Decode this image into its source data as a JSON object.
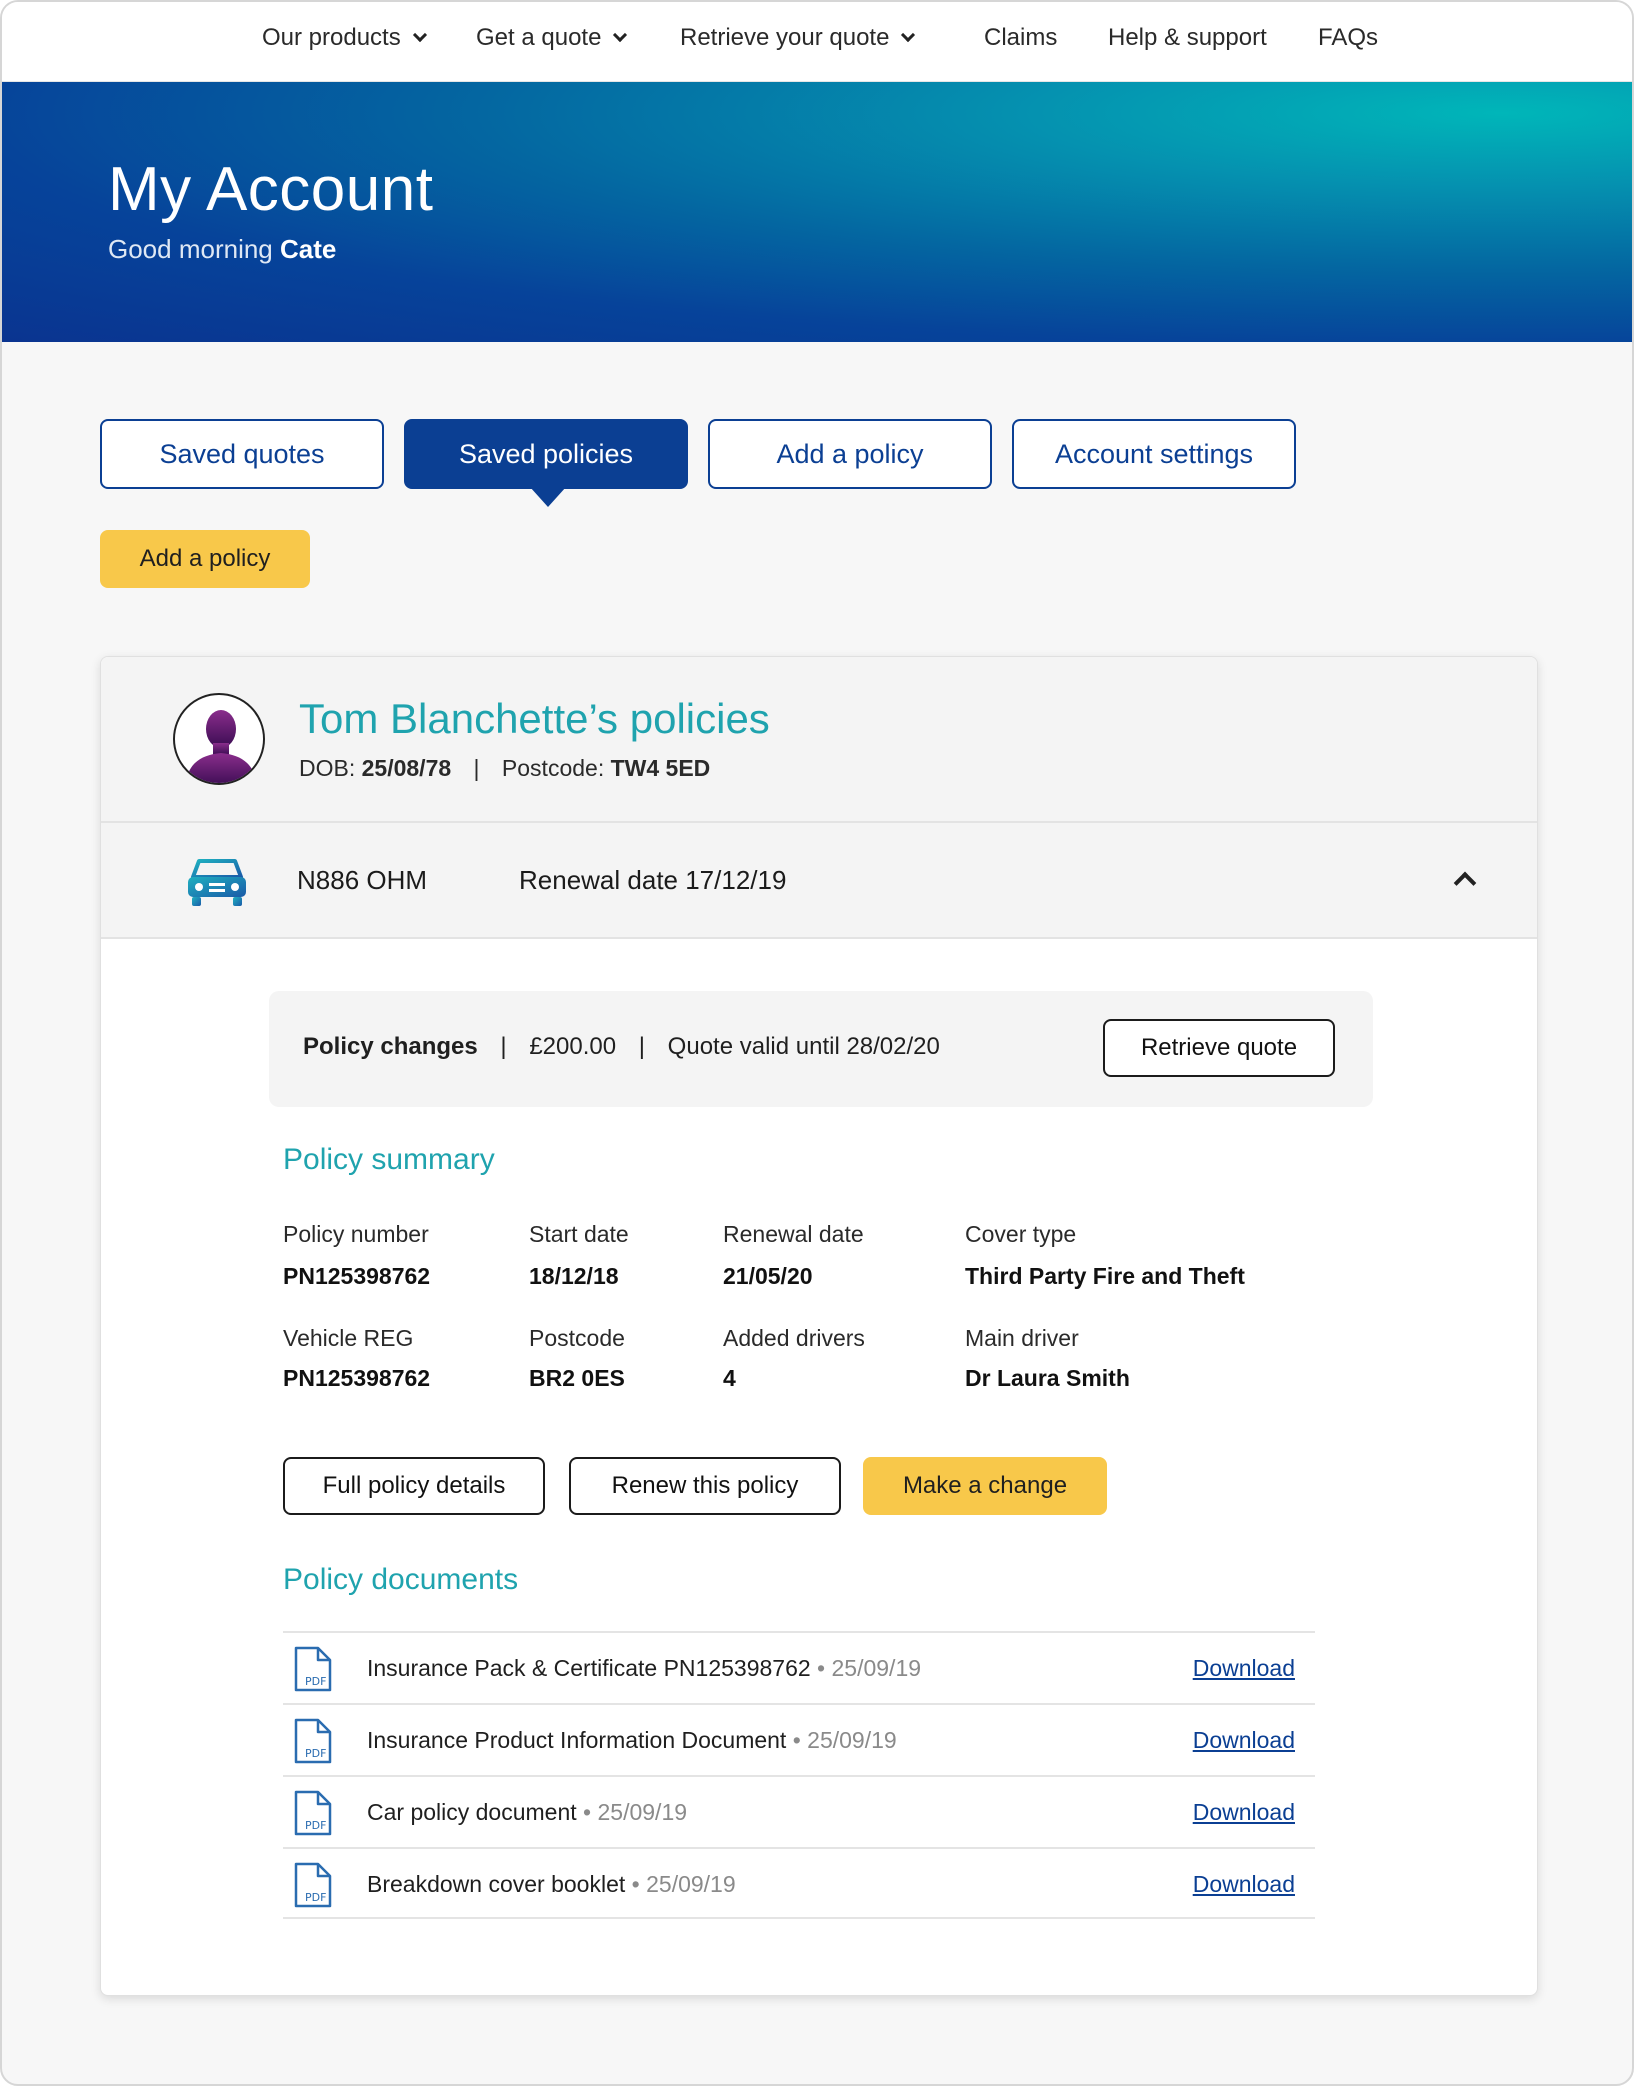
{
  "nav": {
    "items": [
      {
        "label": "Our products",
        "dropdown": true
      },
      {
        "label": "Get a quote",
        "dropdown": true
      },
      {
        "label": "Retrieve your quote",
        "dropdown": true
      },
      {
        "label": "Claims",
        "dropdown": false
      },
      {
        "label": "Help & support",
        "dropdown": false
      },
      {
        "label": "FAQs",
        "dropdown": false
      }
    ]
  },
  "hero": {
    "title": "My Account",
    "greeting": "Good morning",
    "user_name": "Cate"
  },
  "tabs": [
    {
      "label": "Saved quotes",
      "active": false
    },
    {
      "label": "Saved policies",
      "active": true
    },
    {
      "label": "Add a policy",
      "active": false
    },
    {
      "label": "Account settings",
      "active": false
    }
  ],
  "add_policy_button": "Add a policy",
  "card": {
    "title": "Tom Blanchette’s policies",
    "dob_label": "DOB:",
    "dob": "25/08/78",
    "postcode_label": "Postcode:",
    "postcode": "TW4 5ED",
    "vehicle": {
      "icon": "car-icon",
      "reg": "N886 OHM",
      "renewal": "Renewal date 17/12/19"
    },
    "quote": {
      "label": "Policy changes",
      "amount": "£200.00",
      "valid": "Quote valid until 28/02/20",
      "button": "Retrieve quote"
    },
    "summary": {
      "title": "Policy summary",
      "fields": [
        {
          "label": "Policy number",
          "value": "PN125398762"
        },
        {
          "label": "Start date",
          "value": "18/12/18"
        },
        {
          "label": "Renewal date",
          "value": "21/05/20"
        },
        {
          "label": "Cover type",
          "value": "Third Party Fire and Theft"
        },
        {
          "label": "Vehicle REG",
          "value": "PN125398762"
        },
        {
          "label": "Postcode",
          "value": "BR2 0ES"
        },
        {
          "label": "Added drivers",
          "value": "4"
        },
        {
          "label": "Main driver",
          "value": "Dr Laura Smith"
        }
      ]
    },
    "actions": {
      "full_details": "Full policy details",
      "renew": "Renew this policy",
      "change": "Make a change"
    },
    "documents": {
      "title": "Policy documents",
      "download_label": "Download",
      "items": [
        {
          "name": "Insurance Pack & Certificate PN125398762",
          "date": "25/09/19"
        },
        {
          "name": "Insurance Product Information Document",
          "date": "25/09/19"
        },
        {
          "name": "Car policy document",
          "date": "25/09/19"
        },
        {
          "name": "Breakdown cover booklet",
          "date": "25/09/19"
        }
      ]
    }
  },
  "colors": {
    "brand_navy": "#0b3f93",
    "teal": "#1fa3ae",
    "accent_yellow": "#f8c84a"
  }
}
